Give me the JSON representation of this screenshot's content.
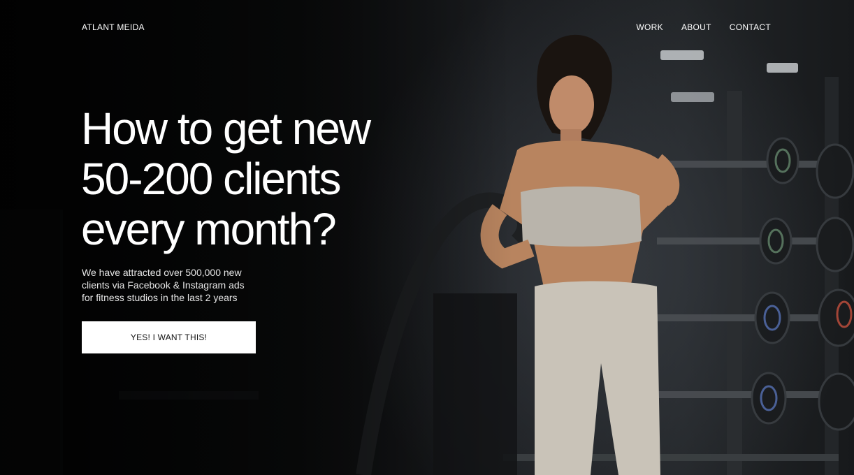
{
  "header": {
    "logo": "ATLANT MEIDA",
    "nav": [
      {
        "label": "WORK"
      },
      {
        "label": "ABOUT"
      },
      {
        "label": "CONTACT"
      }
    ]
  },
  "hero": {
    "headline_line1": "How to get new",
    "headline_line2": "50-200 clients",
    "headline_line3": "every month?",
    "subtext": "We have attracted over 500,000 new clients via Facebook & Instagram ads for fitness studios in the last 2 years",
    "cta_label": "YES! I WANT THIS!",
    "image_description_icon": "fitness-photo"
  },
  "colors": {
    "background": "#0a0a0a",
    "text": "#ffffff",
    "button_bg": "#ffffff",
    "button_text": "#111111"
  }
}
